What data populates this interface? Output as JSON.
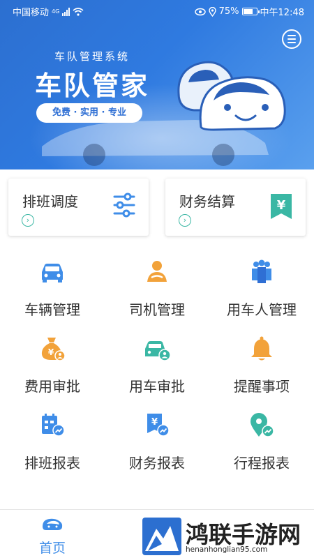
{
  "status_bar": {
    "carrier": "中国移动",
    "network": "4G",
    "battery": "75%",
    "time": "中午12:48"
  },
  "banner": {
    "subtitle": "车队管理系统",
    "title": "车队管家",
    "tagline": "免费 · 实用 · 专业",
    "message_icon": "message-icon"
  },
  "quick_cards": [
    {
      "label": "排班调度",
      "icon": "sliders-icon"
    },
    {
      "label": "财务结算",
      "icon": "yen-ribbon-icon"
    }
  ],
  "menu": [
    {
      "label": "车辆管理",
      "icon": "car-icon",
      "color": "#3f8de8"
    },
    {
      "label": "司机管理",
      "icon": "driver-icon",
      "color": "#f2a23a"
    },
    {
      "label": "用车人管理",
      "icon": "people-icon",
      "color": "#3f8de8"
    },
    {
      "label": "费用审批",
      "icon": "money-bag-icon",
      "color": "#f2a23a"
    },
    {
      "label": "用车审批",
      "icon": "car-approve-icon",
      "color": "#3ab7a4"
    },
    {
      "label": "提醒事项",
      "icon": "bell-icon",
      "color": "#f2a23a"
    },
    {
      "label": "排班报表",
      "icon": "schedule-report-icon",
      "color": "#3f8de8"
    },
    {
      "label": "财务报表",
      "icon": "finance-report-icon",
      "color": "#3f8de8"
    },
    {
      "label": "行程报表",
      "icon": "trip-report-icon",
      "color": "#3ab7a4"
    }
  ],
  "bottom_nav": {
    "home_label": "首页",
    "home_icon": "home-car-icon"
  },
  "watermark": {
    "title": "鸿联手游网",
    "url": "henanhonglian95.com"
  },
  "colors": {
    "primary": "#2f7ae0",
    "accent_blue": "#3f8de8",
    "accent_orange": "#f2a23a",
    "accent_teal": "#3ab7a4"
  }
}
